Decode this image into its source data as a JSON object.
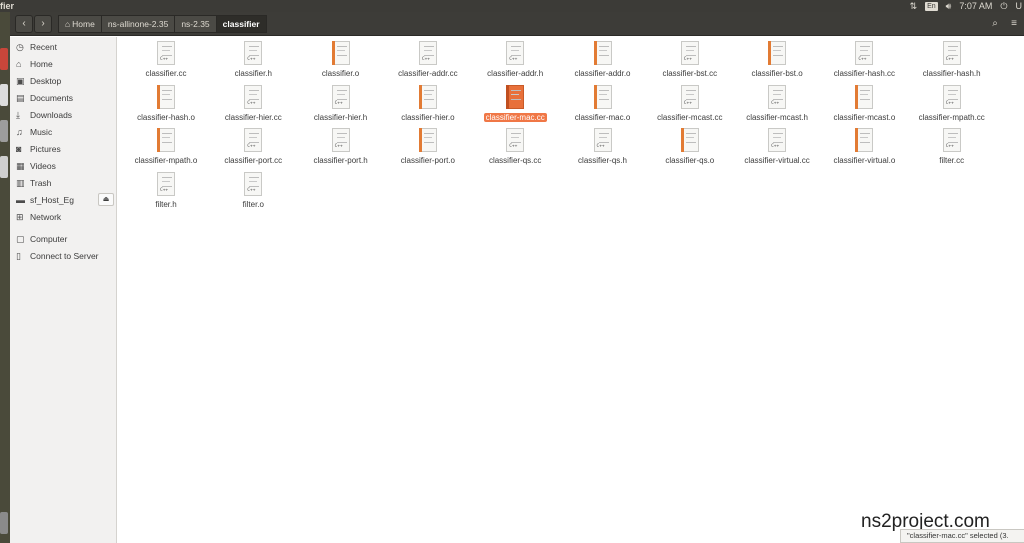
{
  "window": {
    "title": "fier"
  },
  "tray": {
    "keyboard": "En",
    "clock": "7:07 AM",
    "user": "U"
  },
  "breadcrumbs": [
    {
      "label": "Home"
    },
    {
      "label": "ns-allinone-2.35"
    },
    {
      "label": "ns-2.35"
    },
    {
      "label": "classifier"
    }
  ],
  "sidebar": {
    "items": [
      {
        "label": "Recent",
        "icon": "clock-icon"
      },
      {
        "label": "Home",
        "icon": "home-icon"
      },
      {
        "label": "Desktop",
        "icon": "desktop-icon"
      },
      {
        "label": "Documents",
        "icon": "documents-icon"
      },
      {
        "label": "Downloads",
        "icon": "downloads-icon"
      },
      {
        "label": "Music",
        "icon": "music-icon"
      },
      {
        "label": "Pictures",
        "icon": "pictures-icon"
      },
      {
        "label": "Videos",
        "icon": "videos-icon"
      },
      {
        "label": "Trash",
        "icon": "trash-icon"
      },
      {
        "label": "sf_Host_Eg",
        "icon": "drive-icon"
      },
      {
        "label": "Network",
        "icon": "network-icon"
      },
      {
        "label": "Computer",
        "icon": "computer-icon"
      },
      {
        "label": "Connect to Server",
        "icon": "server-icon"
      }
    ]
  },
  "files": [
    {
      "name": "classifier.cc",
      "kind": "cpp"
    },
    {
      "name": "classifier.h",
      "kind": "cpp"
    },
    {
      "name": "classifier.o",
      "kind": "src"
    },
    {
      "name": "classifier-addr.cc",
      "kind": "cpp"
    },
    {
      "name": "classifier-addr.h",
      "kind": "cpp"
    },
    {
      "name": "classifier-addr.o",
      "kind": "src"
    },
    {
      "name": "classifier-bst.cc",
      "kind": "cpp"
    },
    {
      "name": "classifier-bst.o",
      "kind": "src"
    },
    {
      "name": "classifier-hash.cc",
      "kind": "cpp"
    },
    {
      "name": "classifier-hash.h",
      "kind": "cpp"
    },
    {
      "name": "classifier-hash.o",
      "kind": "src"
    },
    {
      "name": "classifier-hier.cc",
      "kind": "cpp"
    },
    {
      "name": "classifier-hier.h",
      "kind": "cpp"
    },
    {
      "name": "classifier-hier.o",
      "kind": "src"
    },
    {
      "name": "classifier-mac.cc",
      "kind": "selected"
    },
    {
      "name": "classifier-mac.o",
      "kind": "src"
    },
    {
      "name": "classifier-mcast.cc",
      "kind": "cpp"
    },
    {
      "name": "classifier-mcast.h",
      "kind": "cpp"
    },
    {
      "name": "classifier-mcast.o",
      "kind": "src"
    },
    {
      "name": "classifier-mpath.cc",
      "kind": "cpp"
    },
    {
      "name": "classifier-mpath.o",
      "kind": "src"
    },
    {
      "name": "classifier-port.cc",
      "kind": "cpp"
    },
    {
      "name": "classifier-port.h",
      "kind": "cpp"
    },
    {
      "name": "classifier-port.o",
      "kind": "src"
    },
    {
      "name": "classifier-qs.cc",
      "kind": "cpp"
    },
    {
      "name": "classifier-qs.h",
      "kind": "cpp"
    },
    {
      "name": "classifier-qs.o",
      "kind": "src"
    },
    {
      "name": "classifier-virtual.cc",
      "kind": "cpp"
    },
    {
      "name": "classifier-virtual.o",
      "kind": "src"
    },
    {
      "name": "filter.cc",
      "kind": "cpp"
    },
    {
      "name": "filter.h",
      "kind": "cpp"
    },
    {
      "name": "filter.o",
      "kind": "cpp"
    }
  ],
  "status": {
    "text": "\"classifier-mac.cc\" selected  (3."
  },
  "watermark": {
    "text": "ns2project.com"
  },
  "colors": {
    "selection": "#f07746",
    "header": "#3d3c38",
    "sidebar": "#f2f1f0"
  }
}
